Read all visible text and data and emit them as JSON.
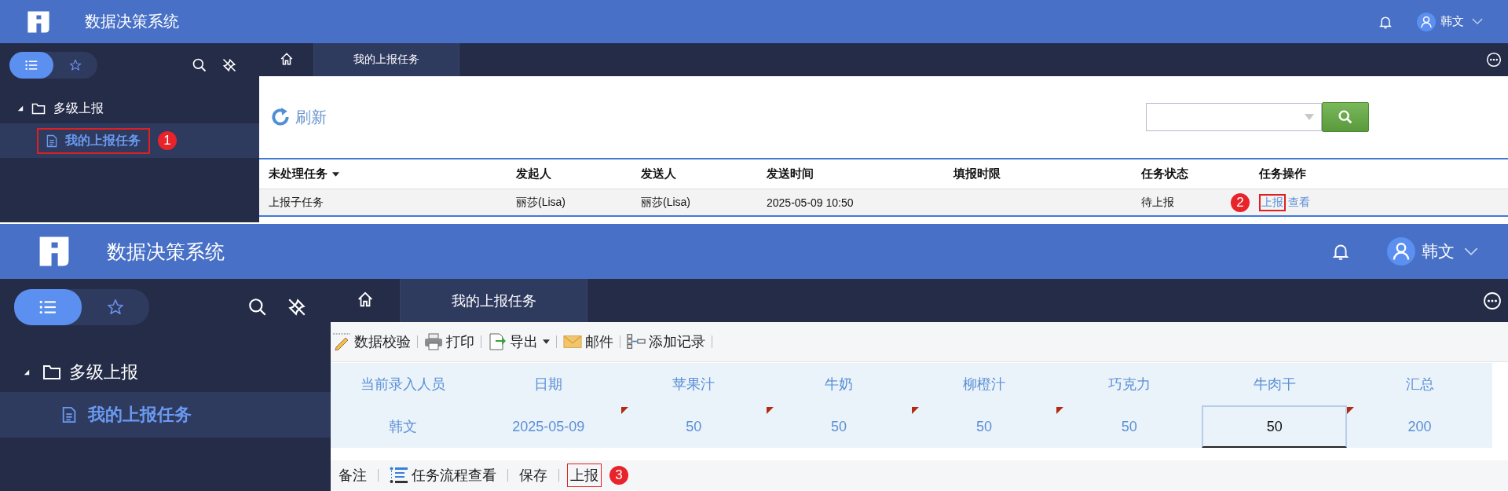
{
  "top_screen": {
    "header": {
      "title": "数据决策系统",
      "user": "韩文"
    },
    "sidebar": {
      "modes": [
        {
          "kind": "list",
          "selected": true
        },
        {
          "kind": "favorites",
          "selected": false
        }
      ],
      "tree": [
        {
          "label": "多级上报",
          "expanded": true,
          "children": [
            {
              "label": "我的上报任务",
              "selected": true,
              "outlined": true,
              "marker": "1"
            }
          ]
        }
      ]
    },
    "tabs": [
      {
        "kind": "home",
        "selected": false
      },
      {
        "kind": "page",
        "label": "我的上报任务",
        "selected": true
      }
    ],
    "refresh_button": "刷新",
    "table": {
      "columns": [
        {
          "label": "未处理任务",
          "sortable": true
        },
        {
          "label": "发起人",
          "sortable": false
        },
        {
          "label": "发送人",
          "sortable": false
        },
        {
          "label": "发送时间",
          "sortable": false
        },
        {
          "label": "填报时限",
          "sortable": false
        },
        {
          "label": "任务状态",
          "sortable": false
        },
        {
          "label": "任务操作",
          "sortable": false
        }
      ],
      "rows": [
        {
          "cells": [
            "上报子任务",
            "丽莎(Lisa)",
            "丽莎(Lisa)",
            "2025-05-09 10:50",
            null,
            "待上报"
          ],
          "actions": [
            {
              "label": "上报",
              "outlined": true,
              "marker": "2"
            },
            {
              "label": "查看",
              "outlined": false
            }
          ]
        }
      ]
    }
  },
  "bottom_screen": {
    "header": {
      "title": "数据决策系统",
      "user": "韩文"
    },
    "sidebar": {
      "modes": [
        {
          "kind": "list",
          "selected": true
        },
        {
          "kind": "favorites",
          "selected": false
        }
      ],
      "tree": [
        {
          "label": "多级上报",
          "expanded": true,
          "children": [
            {
              "label": "我的上报任务",
              "selected": true,
              "outlined": false
            }
          ]
        }
      ]
    },
    "tabs": [
      {
        "kind": "home",
        "selected": false
      },
      {
        "kind": "page",
        "label": "我的上报任务",
        "selected": true
      }
    ],
    "toolbar": [
      {
        "kind": "validate",
        "label": "数据校验",
        "dropdown": false
      },
      {
        "kind": "print",
        "label": "打印",
        "dropdown": false
      },
      {
        "kind": "export",
        "label": "导出",
        "dropdown": true
      },
      {
        "kind": "mail",
        "label": "邮件",
        "dropdown": false
      },
      {
        "kind": "add-record",
        "label": "添加记录",
        "dropdown": false
      }
    ],
    "form": {
      "columns": [
        "当前录入人员",
        "日期",
        "苹果汁",
        "牛奶",
        "柳橙汁",
        "巧克力",
        "牛肉干",
        "汇总"
      ],
      "rows": [
        {
          "cells": [
            {
              "value": "韩文",
              "flagged": false,
              "selected": false
            },
            {
              "value": "2025-05-09",
              "flagged": false,
              "selected": false
            },
            {
              "value": "50",
              "flagged": true,
              "selected": false
            },
            {
              "value": "50",
              "flagged": true,
              "selected": false
            },
            {
              "value": "50",
              "flagged": true,
              "selected": false
            },
            {
              "value": "50",
              "flagged": true,
              "selected": false
            },
            {
              "value": "50",
              "flagged": false,
              "selected": true
            },
            {
              "value": "200",
              "flagged": true,
              "selected": false
            }
          ]
        }
      ]
    },
    "actions": [
      {
        "kind": "plain",
        "label": "备注",
        "outlined": false
      },
      {
        "kind": "flow",
        "label": "任务流程查看",
        "outlined": false
      },
      {
        "kind": "plain",
        "label": "保存",
        "outlined": false
      },
      {
        "kind": "plain",
        "label": "上报",
        "outlined": true,
        "marker": "3"
      }
    ]
  }
}
